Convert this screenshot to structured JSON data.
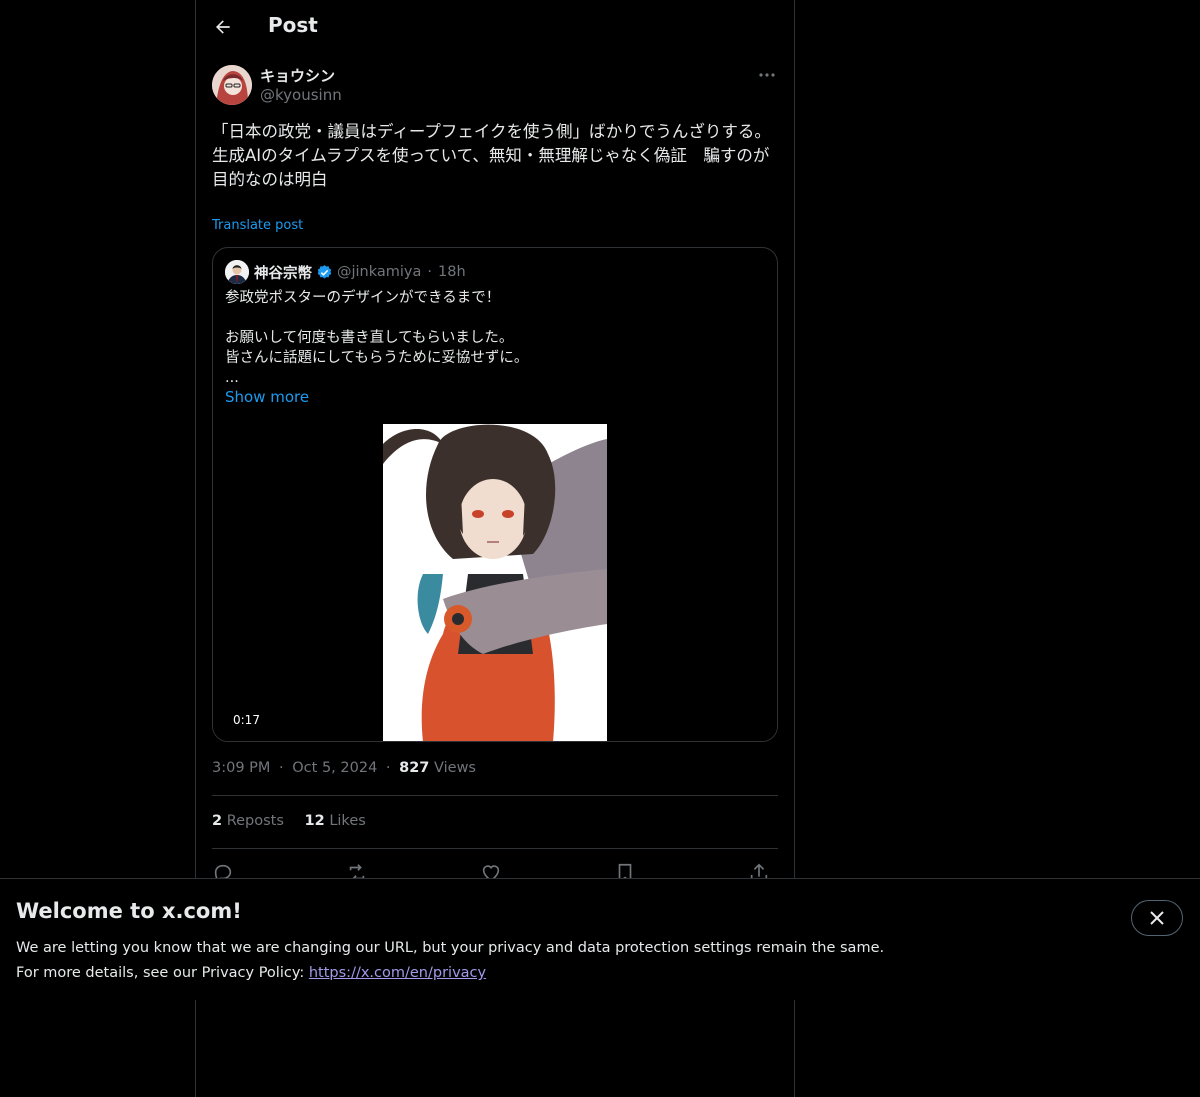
{
  "header": {
    "title": "Post"
  },
  "author": {
    "display_name": "キョウシン",
    "handle": "@kyousinn"
  },
  "post": {
    "text": "「日本の政党・議員はディープフェイクを使う側」ばかりでうんざりする。\n生成AIのタイムラプスを使っていて、無知・無理解じゃなく偽証　騙すのが目的なのは明白",
    "translate_label": "Translate post",
    "time": "3:09 PM",
    "date": "Oct 5, 2024",
    "views_count": "827",
    "views_label": "Views",
    "separator": "·"
  },
  "quote": {
    "display_name": "神谷宗幣",
    "handle": "@jinkamiya",
    "separator": "·",
    "age": "18h",
    "text": "参政党ポスターのデザインができるまで！\n\nお願いして何度も書き直してもらいました。\n皆さんに話題にしてもらうために妥協せずに。\n...",
    "show_more_label": "Show more",
    "video_duration": "0:17",
    "verified_color": "#1d9bf0"
  },
  "stats": {
    "reposts_count": "2",
    "reposts_label": "Reposts",
    "likes_count": "12",
    "likes_label": "Likes"
  },
  "actions": [
    "reply-icon",
    "repost-icon",
    "like-icon",
    "bookmark-icon",
    "share-icon"
  ],
  "banner": {
    "title": "Welcome to x.com!",
    "line1": "We are letting you know that we are changing our URL, but your privacy and data protection settings remain the same.",
    "line2_prefix": "For more details, see our Privacy Policy: ",
    "link": "https://x.com/en/privacy"
  },
  "colors": {
    "accent": "#1d9bf0",
    "background": "#000000",
    "border": "#2f3336",
    "muted": "#71767b",
    "link_banner": "#a09ae8"
  }
}
